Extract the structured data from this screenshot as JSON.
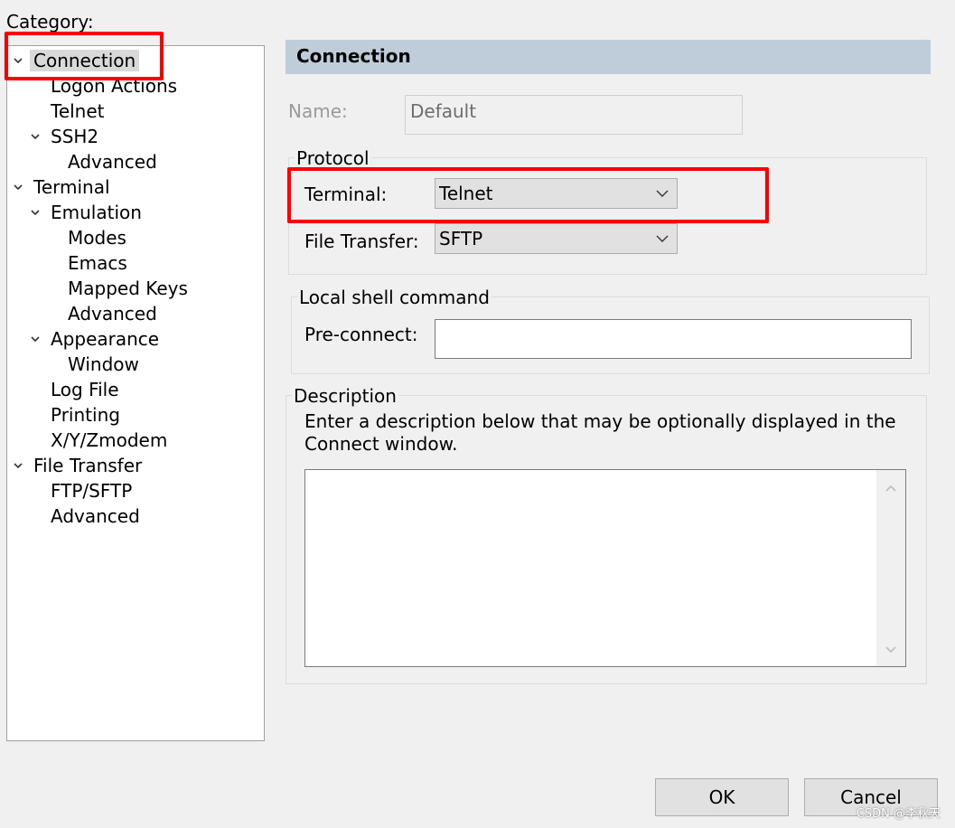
{
  "category_label": "Category:",
  "tree": [
    {
      "label": "Connection",
      "expanded": true,
      "selected": true
    },
    {
      "label": "Logon Actions"
    },
    {
      "label": "Telnet"
    },
    {
      "label": "SSH2",
      "expanded": true
    },
    {
      "label": "Advanced"
    },
    {
      "label": "Terminal",
      "expanded": true
    },
    {
      "label": "Emulation",
      "expanded": true
    },
    {
      "label": "Modes"
    },
    {
      "label": "Emacs"
    },
    {
      "label": "Mapped Keys"
    },
    {
      "label": "Advanced"
    },
    {
      "label": "Appearance",
      "expanded": true
    },
    {
      "label": "Window"
    },
    {
      "label": "Log File"
    },
    {
      "label": "Printing"
    },
    {
      "label": "X/Y/Zmodem"
    },
    {
      "label": "File Transfer",
      "expanded": true
    },
    {
      "label": "FTP/SFTP"
    },
    {
      "label": "Advanced"
    }
  ],
  "panel": {
    "title": "Connection",
    "name_label": "Name:",
    "name_value": "Default",
    "protocol": {
      "group_title": "Protocol",
      "terminal_label": "Terminal:",
      "terminal_value": "Telnet",
      "file_transfer_label": "File Transfer:",
      "file_transfer_value": "SFTP"
    },
    "local_shell": {
      "group_title": "Local shell command",
      "preconnect_label": "Pre-connect:",
      "preconnect_value": ""
    },
    "description": {
      "group_title": "Description",
      "hint": "Enter a description below that may be optionally displayed in the Connect window.",
      "value": ""
    }
  },
  "buttons": {
    "ok": "OK",
    "cancel": "Cancel"
  },
  "watermark": "CSDN @李秋天",
  "colors": {
    "header_bg": "#bfcddb",
    "highlight": "#ff0000",
    "selected_bg": "#d9d9d9"
  },
  "icons": {
    "tree_chevron": "chevron-down-icon",
    "dropdown": "chevron-down-icon",
    "scroll_up": "scroll-up-arrow-icon",
    "scroll_down": "scroll-down-arrow-icon"
  }
}
